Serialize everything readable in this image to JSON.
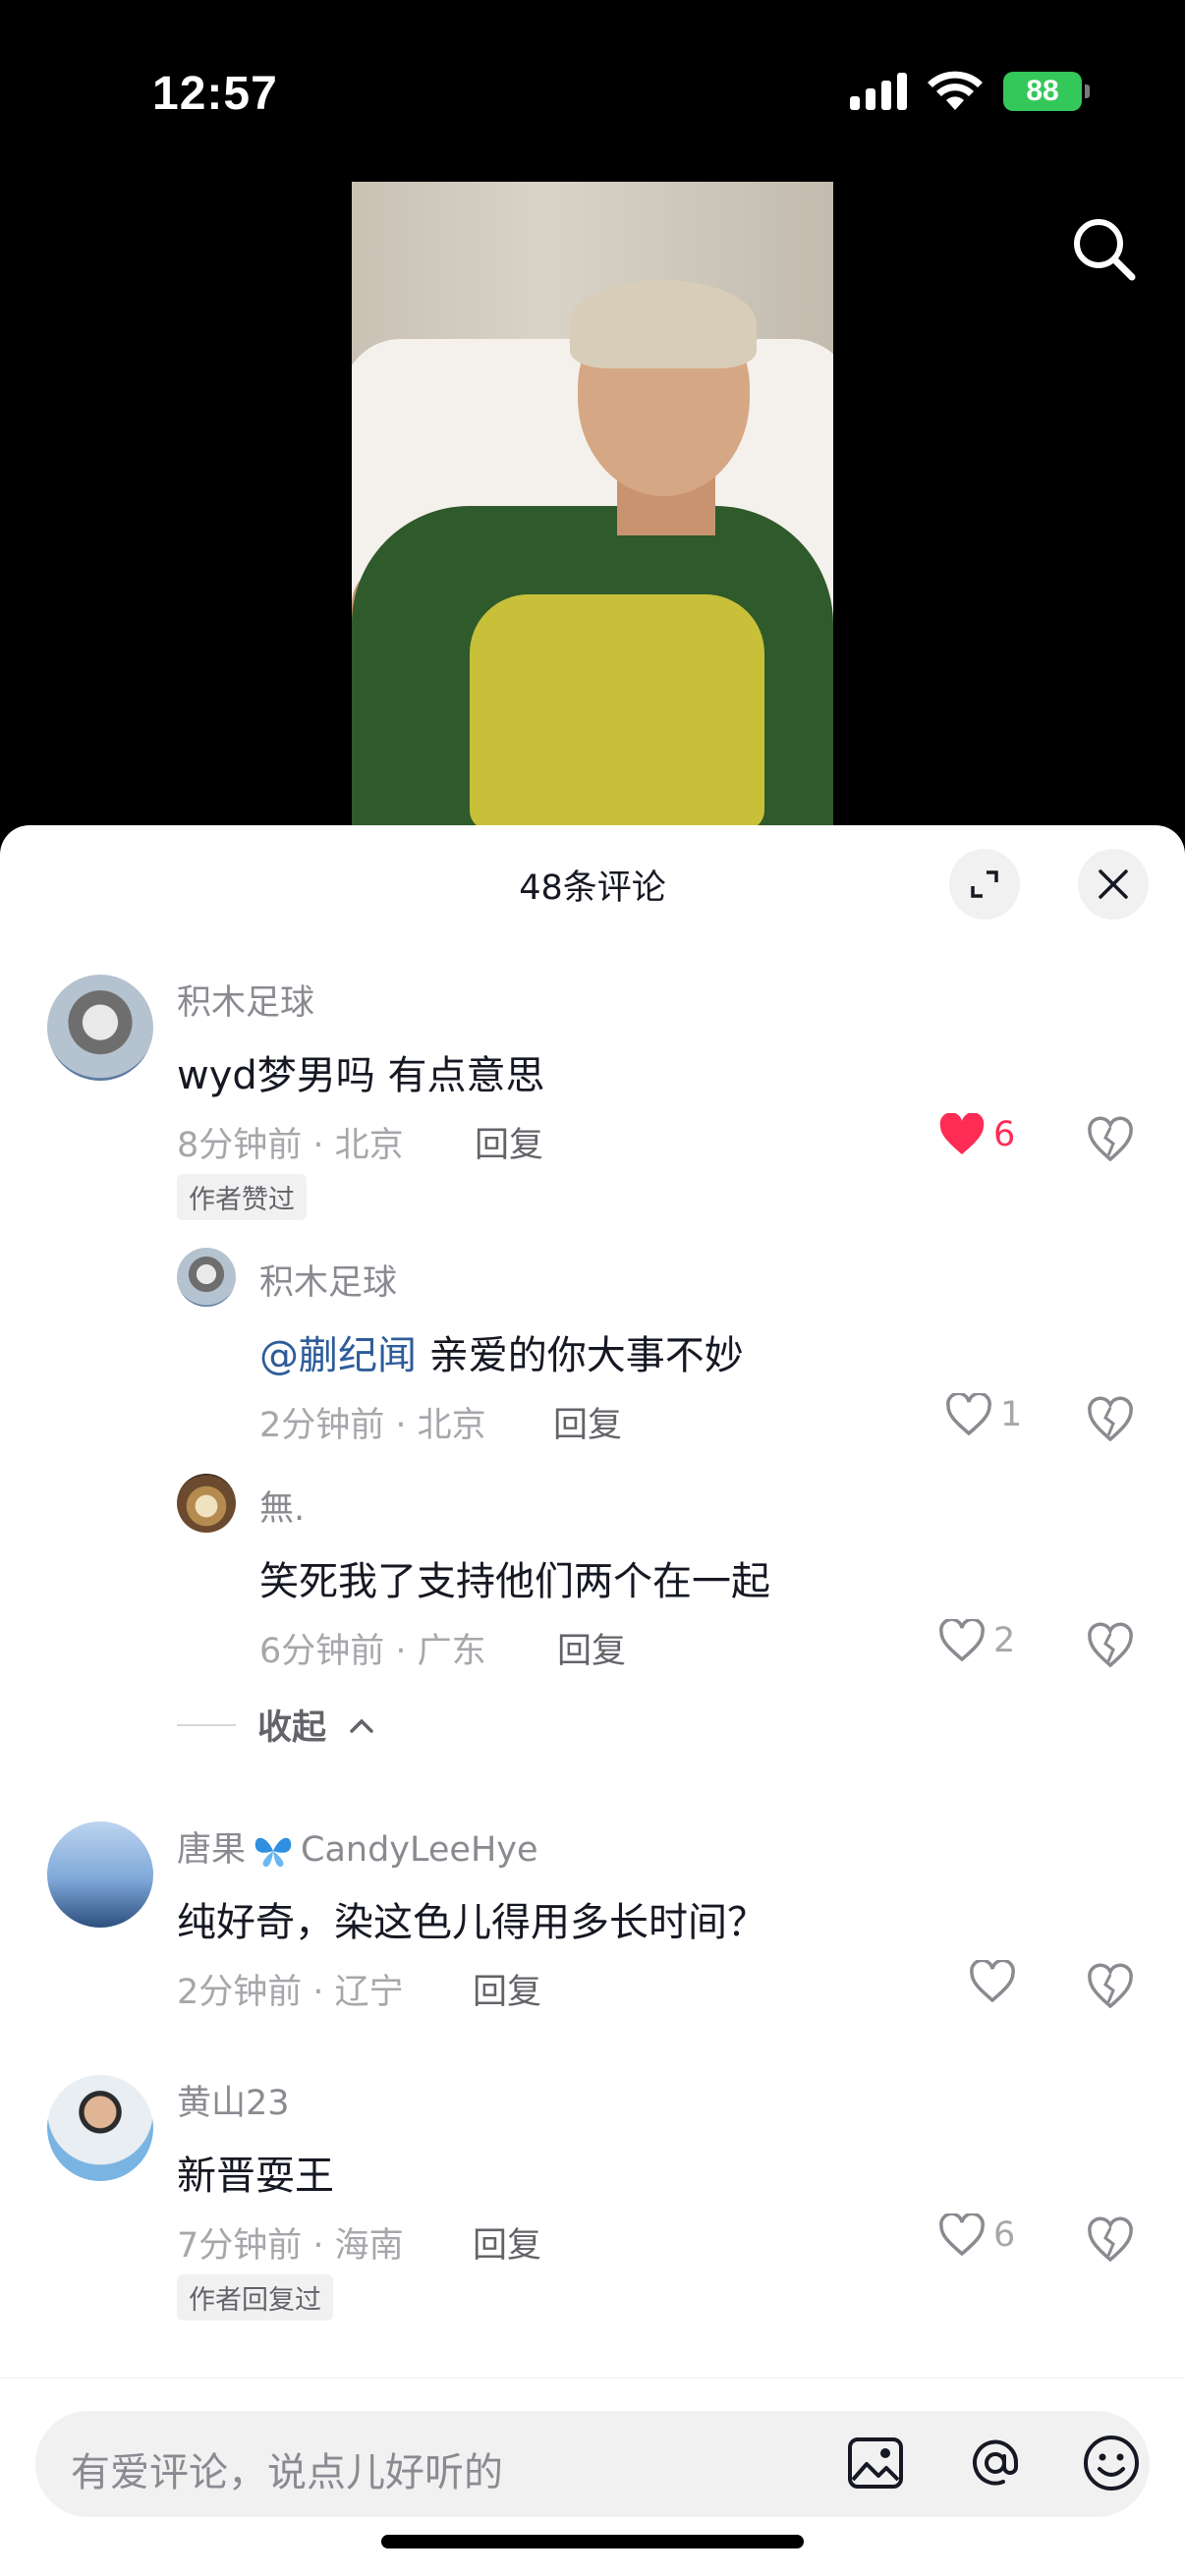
{
  "status": {
    "time": "12:57",
    "battery": "88"
  },
  "sheet": {
    "title": "48条评论"
  },
  "comments": [
    {
      "name": "积木足球",
      "text": "wyd梦男吗 有点意思",
      "time_loc": "8分钟前 · 北京",
      "reply": "回复",
      "likes": "6",
      "badge": "作者赞过"
    },
    {
      "name": "积木足球",
      "mention": "@蒯纪闻",
      "text": "亲爱的你大事不妙",
      "time_loc": "2分钟前 · 北京",
      "reply": "回复",
      "likes": "1"
    },
    {
      "name": "無.",
      "text": "笑死我了支持他们两个在一起",
      "time_loc": "6分钟前 · 广东",
      "reply": "回复",
      "likes": "2"
    },
    {
      "name_pre": "唐果",
      "name_post": "CandyLeeHye",
      "text": "纯好奇，染这色儿得用多长时间？",
      "time_loc": "2分钟前 · 辽宁",
      "reply": "回复"
    },
    {
      "name": "黄山23",
      "text": "新晋耍王",
      "time_loc": "7分钟前 · 海南",
      "reply": "回复",
      "likes": "6",
      "badge": "作者回复过"
    }
  ],
  "collapse_label": "收起",
  "input": {
    "placeholder": "有爱评论，说点儿好听的"
  },
  "icons": [
    "search-icon",
    "expand-icon",
    "close-icon",
    "heart-icon",
    "dislike-icon",
    "image-icon",
    "at-icon",
    "emoji-icon",
    "chevron-up-icon",
    "butterfly-icon"
  ],
  "colors": {
    "like_active": "#fe2c55",
    "mention": "#2f5c9a",
    "battery": "#34c759"
  }
}
